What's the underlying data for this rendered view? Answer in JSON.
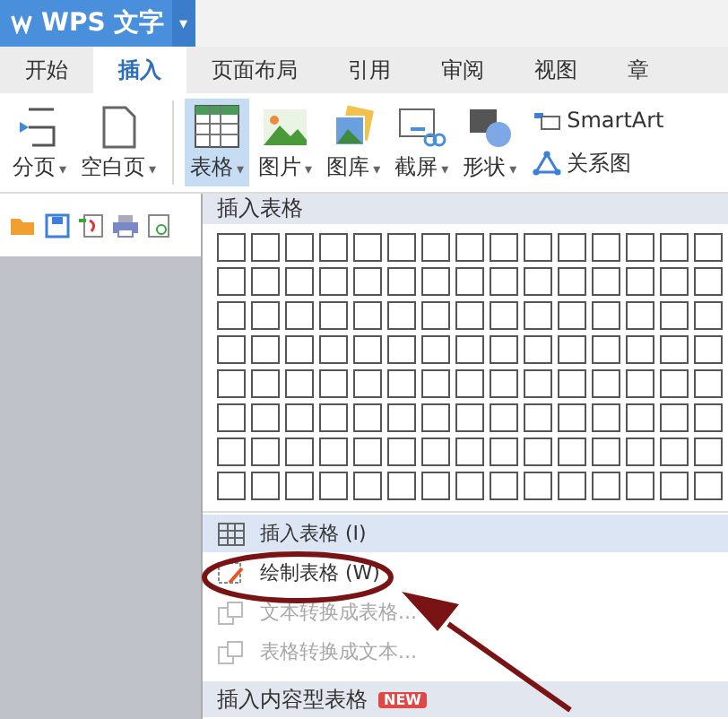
{
  "app": {
    "title": "WPS 文字",
    "menu_caret": "▾"
  },
  "tabs": [
    {
      "label": "开始",
      "selected": false
    },
    {
      "label": "插入",
      "selected": true
    },
    {
      "label": "页面布局",
      "selected": false
    },
    {
      "label": "引用",
      "selected": false
    },
    {
      "label": "审阅",
      "selected": false
    },
    {
      "label": "视图",
      "selected": false
    },
    {
      "label": "章",
      "selected": false
    }
  ],
  "ribbon_left": [
    {
      "label": "分页",
      "caret": "▾"
    },
    {
      "label": "空白页",
      "caret": "▾"
    }
  ],
  "ribbon_main": [
    {
      "label": "表格",
      "caret": "▾",
      "selected": true
    },
    {
      "label": "图片",
      "caret": "▾",
      "selected": false
    },
    {
      "label": "图库",
      "caret": "▾",
      "selected": false
    },
    {
      "label": "截屏",
      "caret": "▾",
      "selected": false
    },
    {
      "label": "形状",
      "caret": "▾",
      "selected": false
    }
  ],
  "ribbon_small": [
    {
      "label": "SmartArt"
    },
    {
      "label": "关系图"
    }
  ],
  "table_menu": {
    "grid_title": "插入表格",
    "items": [
      {
        "kind": "item",
        "label": "插入表格 (I)",
        "selected": true,
        "disabled": false
      },
      {
        "kind": "item",
        "label": "绘制表格 (W)",
        "selected": false,
        "disabled": false
      },
      {
        "kind": "item",
        "label": "文本转换成表格...",
        "selected": false,
        "disabled": true
      },
      {
        "kind": "item",
        "label": "表格转换成文本...",
        "selected": false,
        "disabled": true
      },
      {
        "kind": "header",
        "label": "插入内容型表格",
        "badge": "NEW"
      }
    ]
  }
}
